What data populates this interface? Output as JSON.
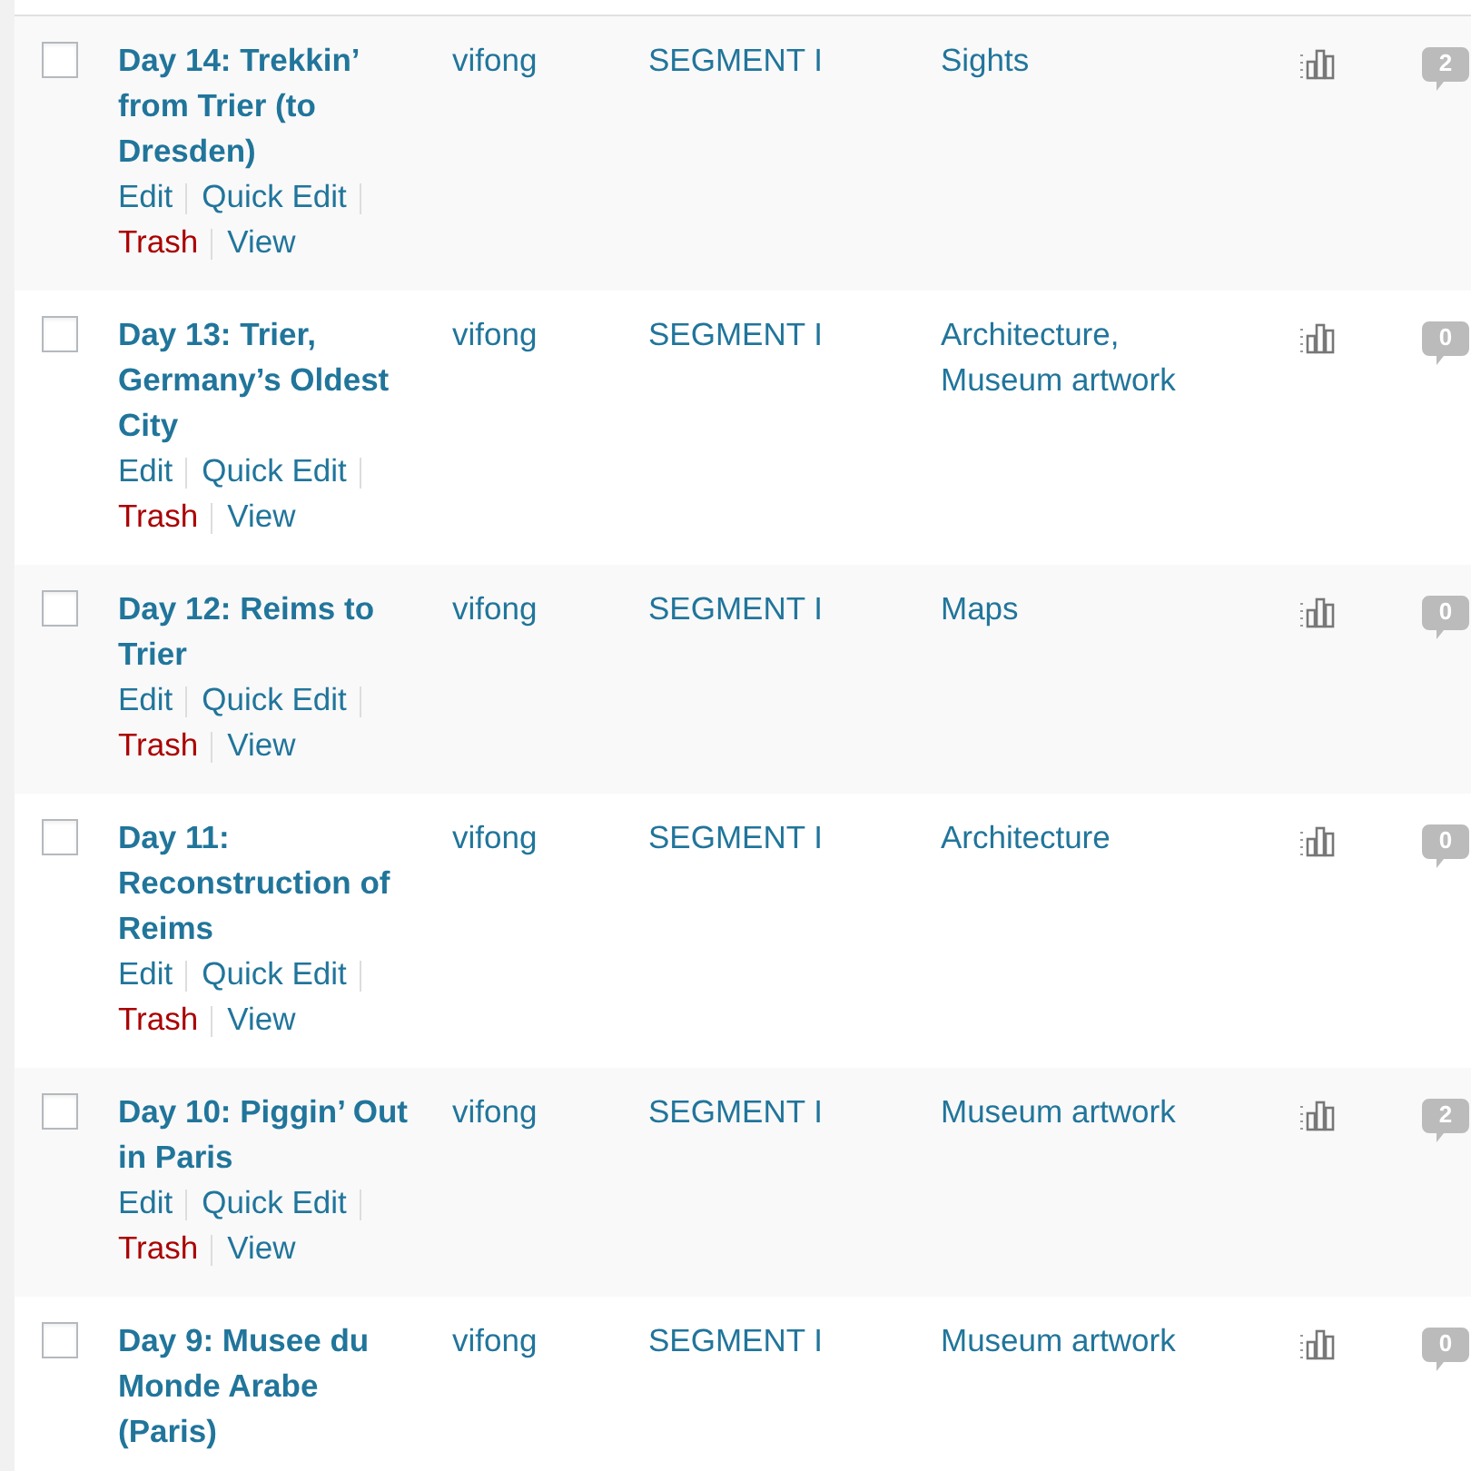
{
  "posts": [
    {
      "title": "Day 14: Trekkin’ from Trier (to Dresden)",
      "selected": false,
      "actions": [
        {
          "label": "Edit",
          "kind": "normal"
        },
        {
          "label": "Quick Edit",
          "kind": "normal"
        },
        {
          "label": "Trash",
          "kind": "danger"
        },
        {
          "label": "View",
          "kind": "normal"
        }
      ],
      "author": "vifong",
      "category": "SEGMENT I",
      "tags": "Sights",
      "comments": "2"
    },
    {
      "title": "Day 13: Trier, Germany’s Oldest City",
      "selected": false,
      "actions": [
        {
          "label": "Edit",
          "kind": "normal"
        },
        {
          "label": "Quick Edit",
          "kind": "normal"
        },
        {
          "label": "Trash",
          "kind": "danger"
        },
        {
          "label": "View",
          "kind": "normal"
        }
      ],
      "author": "vifong",
      "category": "SEGMENT I",
      "tags": "Architecture, Museum artwork",
      "comments": "0"
    },
    {
      "title": "Day 12: Reims to Trier",
      "selected": false,
      "actions": [
        {
          "label": "Edit",
          "kind": "normal"
        },
        {
          "label": "Quick Edit",
          "kind": "normal"
        },
        {
          "label": "Trash",
          "kind": "danger"
        },
        {
          "label": "View",
          "kind": "normal"
        }
      ],
      "author": "vifong",
      "category": "SEGMENT I",
      "tags": "Maps",
      "comments": "0"
    },
    {
      "title": "Day 11: Reconstruction of Reims",
      "selected": false,
      "actions": [
        {
          "label": "Edit",
          "kind": "normal"
        },
        {
          "label": "Quick Edit",
          "kind": "normal"
        },
        {
          "label": "Trash",
          "kind": "danger"
        },
        {
          "label": "View",
          "kind": "normal"
        }
      ],
      "author": "vifong",
      "category": "SEGMENT I",
      "tags": "Architecture",
      "comments": "0"
    },
    {
      "title": "Day 10: Piggin’ Out in Paris",
      "selected": false,
      "actions": [
        {
          "label": "Edit",
          "kind": "normal"
        },
        {
          "label": "Quick Edit",
          "kind": "normal"
        },
        {
          "label": "Trash",
          "kind": "danger"
        },
        {
          "label": "View",
          "kind": "normal"
        }
      ],
      "author": "vifong",
      "category": "SEGMENT I",
      "tags": "Museum artwork",
      "comments": "2"
    },
    {
      "title": "Day 9: Musee du Monde Arabe (Paris)",
      "selected": false,
      "author": "vifong",
      "category": "SEGMENT I",
      "tags": "Museum artwork",
      "comments": "0"
    }
  ]
}
